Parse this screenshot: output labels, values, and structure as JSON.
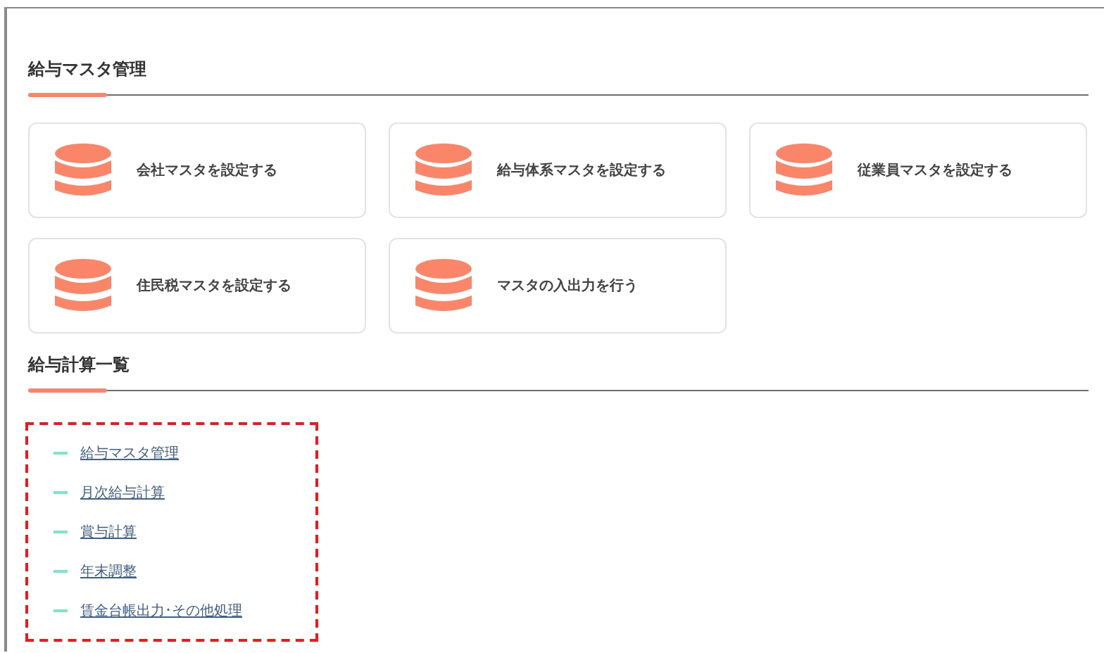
{
  "sections": [
    {
      "title": "給与マスタ管理",
      "cards": [
        {
          "label": "会社マスタを設定する"
        },
        {
          "label": "給与体系マスタを設定する"
        },
        {
          "label": "従業員マスタを設定する"
        },
        {
          "label": "住民税マスタを設定する"
        },
        {
          "label": "マスタの入出力を行う"
        }
      ]
    },
    {
      "title": "給与計算一覧",
      "links": [
        {
          "label": "給与マスタ管理"
        },
        {
          "label": "月次給与計算"
        },
        {
          "label": "賞与計算"
        },
        {
          "label": "年末調整"
        },
        {
          "label": "賃金台帳出力･その他処理"
        }
      ]
    }
  ]
}
